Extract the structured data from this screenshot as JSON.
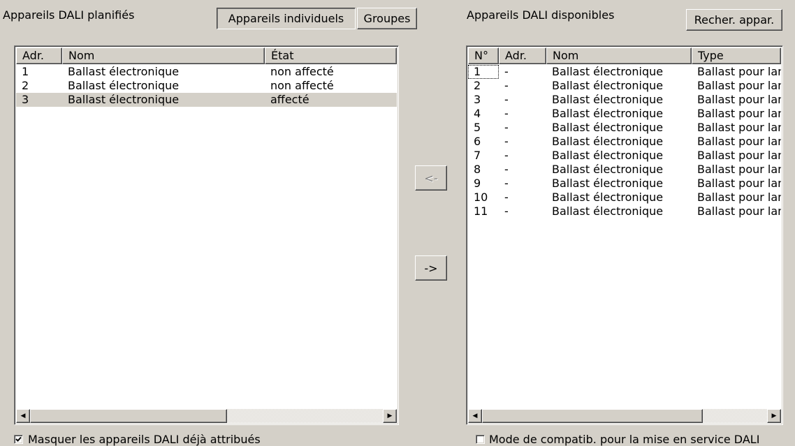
{
  "planned": {
    "title": "Appareils DALI planifiés",
    "tab_individual": "Appareils individuels",
    "tab_groups": "Groupes",
    "columns": [
      "Adr.",
      "Nom",
      "État"
    ],
    "rows": [
      {
        "adr": "1",
        "nom": "Ballast électronique",
        "etat": "non affecté"
      },
      {
        "adr": "2",
        "nom": "Ballast électronique",
        "etat": "non affecté"
      },
      {
        "adr": "3",
        "nom": "Ballast électronique",
        "etat": "affecté"
      }
    ],
    "hide_checkbox_label": "Masquer les appareils DALI déjà attribués",
    "hide_checked": true
  },
  "transfer": {
    "left_label": "<-",
    "right_label": "->"
  },
  "available": {
    "title": "Appareils DALI disponibles",
    "search_button": "Recher. appar.",
    "columns": [
      "N°",
      "Adr.",
      "Nom",
      "Type"
    ],
    "rows": [
      {
        "num": "1",
        "adr": "-",
        "nom": "Ballast électronique",
        "type": "Ballast pour lan"
      },
      {
        "num": "2",
        "adr": "-",
        "nom": "Ballast électronique",
        "type": "Ballast pour lan"
      },
      {
        "num": "3",
        "adr": "-",
        "nom": "Ballast électronique",
        "type": "Ballast pour lan"
      },
      {
        "num": "4",
        "adr": "-",
        "nom": "Ballast électronique",
        "type": "Ballast pour lan"
      },
      {
        "num": "5",
        "adr": "-",
        "nom": "Ballast électronique",
        "type": "Ballast pour lan"
      },
      {
        "num": "6",
        "adr": "-",
        "nom": "Ballast électronique",
        "type": "Ballast pour lan"
      },
      {
        "num": "7",
        "adr": "-",
        "nom": "Ballast électronique",
        "type": "Ballast pour lan"
      },
      {
        "num": "8",
        "adr": "-",
        "nom": "Ballast électronique",
        "type": "Ballast pour lan"
      },
      {
        "num": "9",
        "adr": "-",
        "nom": "Ballast électronique",
        "type": "Ballast pour lan"
      },
      {
        "num": "10",
        "adr": "-",
        "nom": "Ballast électronique",
        "type": "Ballast pour lan"
      },
      {
        "num": "11",
        "adr": "-",
        "nom": "Ballast électronique",
        "type": "Ballast pour lan"
      }
    ],
    "compat_checkbox_label": "Mode de compatib. pour la mise en service DALI",
    "compat_checked": false
  }
}
